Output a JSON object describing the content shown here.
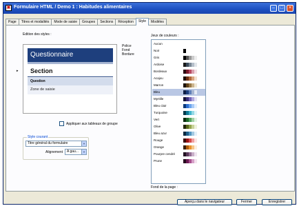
{
  "window": {
    "title": "Formulaire HTML / Demo 1 : Habitudes alimentaires",
    "icon": "app-icon"
  },
  "tabs": [
    {
      "label": "Page",
      "active": false
    },
    {
      "label": "Titres et modalités",
      "active": false
    },
    {
      "label": "Mode de saisie",
      "active": false
    },
    {
      "label": "Groupes",
      "active": false
    },
    {
      "label": "Sections",
      "active": false
    },
    {
      "label": "Réception",
      "active": false
    },
    {
      "label": "Style",
      "active": true
    },
    {
      "label": "Modèles",
      "active": false
    }
  ],
  "styles": {
    "heading": "Edition des styles :",
    "preview": {
      "questionnaire": "Questionnaire",
      "section": "Section",
      "question": "Question",
      "zone": "Zone de saisie"
    },
    "legend": [
      "Police",
      "Fond",
      "Bordure"
    ],
    "apply_to_group_tables": "Appliquer aux tableaux de groupe",
    "current_style": {
      "legend": "Style courant",
      "element": "Titre général du formulaire",
      "alignment_label": "Alignement",
      "alignment_value": "A gau..."
    }
  },
  "palette": {
    "heading": "Jeux de couleurs :",
    "selected": "Bleu",
    "items": [
      {
        "name": "Aucun",
        "colors": []
      },
      {
        "name": "Noir",
        "colors": [
          "#000000"
        ]
      },
      {
        "name": "Gris",
        "colors": [
          "#000000",
          "#555555",
          "#999999",
          "#cccccc",
          "#eeeeee"
        ]
      },
      {
        "name": "Ardoise",
        "colors": [
          "#1a1a1a",
          "#3b4a5a",
          "#7a8896",
          "#b5bfc9",
          "#e1e6ea"
        ]
      },
      {
        "name": "Bordeaux",
        "colors": [
          "#2b0a10",
          "#7a1a2c",
          "#b84a62",
          "#d9a0ae",
          "#f2dde3"
        ]
      },
      {
        "name": "Acajou",
        "colors": [
          "#1f0d05",
          "#6e2f12",
          "#b0683c",
          "#d9a57f",
          "#f3dfcf"
        ]
      },
      {
        "name": "Marron",
        "colors": [
          "#1c1206",
          "#5e4018",
          "#9a7a48",
          "#cbb48d",
          "#efe6d4"
        ]
      },
      {
        "name": "Bleu",
        "colors": [
          "#0e1f45",
          "#1e3f7d",
          "#5f7fb8",
          "#a8b6d2",
          "#e6ebf5"
        ]
      },
      {
        "name": "Myrtille",
        "colors": [
          "#16133a",
          "#3a2f7c",
          "#7364b8",
          "#b2a9dc",
          "#e6e2f6"
        ]
      },
      {
        "name": "Bleu clair",
        "colors": [
          "#0b3a7a",
          "#2f6fd0",
          "#6aa3ec",
          "#a9cbf6",
          "#e3effd"
        ]
      },
      {
        "name": "Turquoise",
        "colors": [
          "#063a4a",
          "#0f7a96",
          "#3fb4cc",
          "#94d9e6",
          "#e0f5f9"
        ]
      },
      {
        "name": "Vert",
        "colors": [
          "#0a2d0e",
          "#1f6a2a",
          "#55a45f",
          "#a3d1a6",
          "#e3f3e4"
        ]
      },
      {
        "name": "Olive",
        "colors": [
          "#22250a",
          "#5a6a1c",
          "#94a44e",
          "#c8d39a",
          "#eef2dc"
        ]
      },
      {
        "name": "Bleu azur",
        "colors": [
          "#0a2a40",
          "#1e5f8a",
          "#5296c0",
          "#a2c9e1",
          "#e3f0f8"
        ]
      },
      {
        "name": "Rouge",
        "colors": [
          "#3a0606",
          "#9a1414",
          "#d84a4a",
          "#f0a0a0",
          "#fce3e3"
        ]
      },
      {
        "name": "Orange",
        "colors": [
          "#3a1e02",
          "#b05a08",
          "#e8922e",
          "#f6c688",
          "#fdeedd"
        ]
      },
      {
        "name": "Pourpre cendré",
        "colors": [
          "#241424",
          "#5a3a5a",
          "#946e94",
          "#c9afc9",
          "#efe4ef"
        ]
      },
      {
        "name": "Prune",
        "colors": [
          "#26081e",
          "#6a1a52",
          "#a8508e",
          "#d6a0c8",
          "#f4e2ef"
        ]
      }
    ]
  },
  "page_background": {
    "label": "Fond de la page :"
  },
  "buttons": {
    "preview": "Aperçu dans le navigateur",
    "close": "Fermer",
    "save": "Enregistrer"
  }
}
